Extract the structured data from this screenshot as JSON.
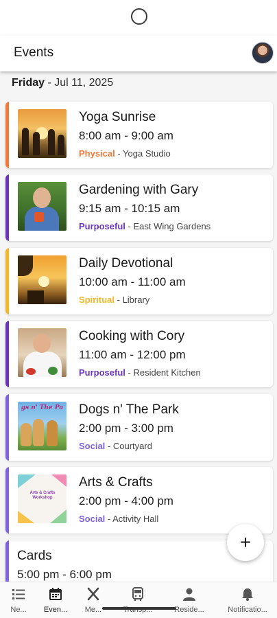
{
  "header": {
    "title": "Events"
  },
  "date": {
    "day": "Friday",
    "rest": " - Jul 11, 2025"
  },
  "events": [
    {
      "title": "Yoga Sunrise",
      "time": "8:00 am - 9:00 am",
      "category": "Physical",
      "location": " - Yoga Studio",
      "color": "#f07a3a"
    },
    {
      "title": "Gardening with Gary",
      "time": "9:15 am - 10:15 am",
      "category": "Purposeful",
      "location": " - East Wing Gardens",
      "color": "#6a35b8"
    },
    {
      "title": "Daily Devotional",
      "time": "10:00 am - 11:00 am",
      "category": "Spiritual",
      "location": " - Library",
      "color": "#f2b82a"
    },
    {
      "title": "Cooking with Cory",
      "time": "11:00 am - 12:00 pm",
      "category": "Purposeful",
      "location": " - Resident Kitchen",
      "color": "#6a35b8"
    },
    {
      "title": "Dogs n' The Park",
      "time": "2:00 pm - 3:00 pm",
      "category": "Social",
      "location": " - Courtyard",
      "color": "#7e62e0"
    },
    {
      "title": "Arts & Crafts",
      "time": "2:00 pm - 4:00 pm",
      "category": "Social",
      "location": " - Activity Hall",
      "color": "#7e62e0"
    },
    {
      "title": "Cards",
      "time": "5:00 pm - 6:00 pm",
      "color": "#7e62e0"
    }
  ],
  "thumbnail_text": {
    "dogs_banner": "gs n' The Pa",
    "arts": "Arts & Crafts Workshop"
  },
  "fab": {
    "label": "+"
  },
  "nav": [
    {
      "label": "Ne...",
      "icon": "list-icon"
    },
    {
      "label": "Even...",
      "icon": "calendar-icon"
    },
    {
      "label": "Me...",
      "icon": "utensils-icon"
    },
    {
      "label": "Transp...",
      "icon": "bus-icon"
    },
    {
      "label": "Reside...",
      "icon": "person-icon"
    },
    {
      "label": "Notificatio...",
      "icon": "bell-icon"
    }
  ]
}
